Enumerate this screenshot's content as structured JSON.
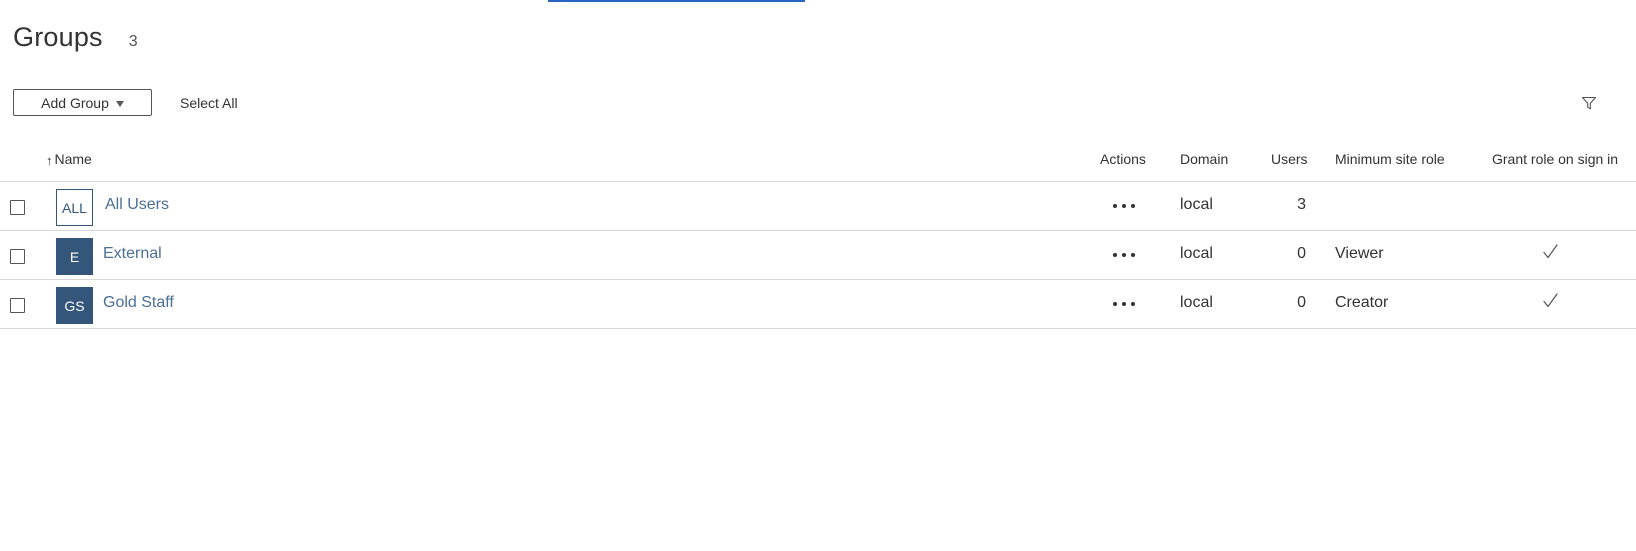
{
  "page": {
    "title": "Groups",
    "count": "3"
  },
  "toolbar": {
    "add_group_label": "Add Group",
    "select_all_label": "Select All"
  },
  "icons": {
    "filter": "filter-icon",
    "sort": "arrow-up-icon",
    "actions": "more-horizontal-icon",
    "grant": "check-icon",
    "dropdown": "caret-down-icon"
  },
  "colors": {
    "avatar": "#34567a",
    "link": "#4a6f98",
    "top_accent": "#2a64c5"
  },
  "table": {
    "sort_arrow": "↑",
    "columns": {
      "name": "Name",
      "actions": "Actions",
      "domain": "Domain",
      "users": "Users",
      "min_role": "Minimum site role",
      "grant": "Grant role on sign in"
    },
    "rows": [
      {
        "initials": "ALL",
        "name": "All Users",
        "domain": "local",
        "users": "3",
        "min_role": "",
        "grant_role_on_sign_in": false
      },
      {
        "initials": "E",
        "name": "External",
        "domain": "local",
        "users": "0",
        "min_role": "Viewer",
        "grant_role_on_sign_in": true
      },
      {
        "initials": "GS",
        "name": "Gold Staff",
        "domain": "local",
        "users": "0",
        "min_role": "Creator",
        "grant_role_on_sign_in": true
      }
    ]
  }
}
